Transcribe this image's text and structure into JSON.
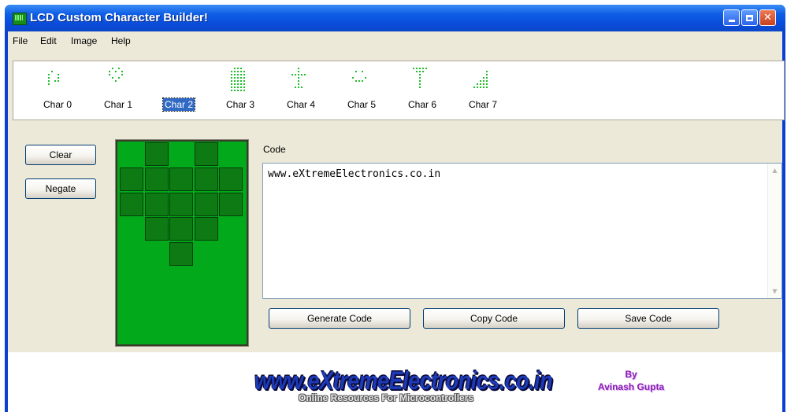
{
  "window": {
    "title": "LCD Custom Character Builder!"
  },
  "menu": {
    "items": [
      "File",
      "Edit",
      "Image",
      "Help"
    ]
  },
  "characters": {
    "selected": "Char 2",
    "items": [
      {
        "label": "Char 0",
        "rows": [
          0,
          0,
          0,
          0,
          0,
          0,
          1,
          0,
          0,
          0,
          1,
          0,
          0,
          1,
          0,
          1,
          0,
          0,
          1,
          0,
          1,
          0,
          1,
          1,
          0,
          1,
          0,
          0,
          0,
          0,
          0,
          0,
          0,
          0,
          0,
          0,
          0,
          0,
          0,
          0
        ]
      },
      {
        "label": "Char 1",
        "rows": [
          0,
          1,
          0,
          1,
          0,
          1,
          0,
          1,
          0,
          1,
          1,
          0,
          0,
          0,
          1,
          0,
          1,
          0,
          1,
          0,
          0,
          0,
          1,
          0,
          0,
          0,
          0,
          0,
          0,
          0,
          0,
          0,
          0,
          0,
          0,
          0,
          0,
          0,
          0,
          0
        ]
      },
      {
        "label": "Char 2",
        "rows": [
          0,
          0,
          0,
          0,
          0,
          0,
          0,
          0,
          0,
          0,
          0,
          0,
          0,
          0,
          0,
          0,
          0,
          0,
          0,
          0,
          0,
          0,
          0,
          0,
          0,
          0,
          0,
          0,
          0,
          0,
          0,
          0,
          0,
          0,
          0,
          0,
          0,
          0,
          0,
          0
        ]
      },
      {
        "label": "Char 3",
        "rows": [
          0,
          1,
          1,
          1,
          0,
          1,
          1,
          1,
          1,
          1,
          1,
          1,
          1,
          1,
          1,
          1,
          1,
          1,
          1,
          1,
          1,
          1,
          1,
          1,
          1,
          1,
          1,
          1,
          1,
          1,
          1,
          1,
          1,
          1,
          1,
          1,
          1,
          1,
          1,
          1
        ]
      },
      {
        "label": "Char 4",
        "rows": [
          0,
          0,
          1,
          0,
          0,
          0,
          0,
          1,
          0,
          0,
          1,
          1,
          1,
          1,
          1,
          0,
          0,
          1,
          0,
          0,
          0,
          0,
          1,
          0,
          0,
          0,
          0,
          1,
          0,
          0,
          0,
          1,
          1,
          1,
          0,
          0,
          0,
          0,
          0,
          0
        ]
      },
      {
        "label": "Char 5",
        "rows": [
          0,
          0,
          0,
          0,
          0,
          0,
          1,
          0,
          1,
          0,
          0,
          0,
          0,
          0,
          0,
          1,
          0,
          0,
          0,
          1,
          0,
          1,
          1,
          1,
          0,
          0,
          0,
          0,
          0,
          0,
          0,
          0,
          0,
          0,
          0,
          0,
          0,
          0,
          0,
          0
        ]
      },
      {
        "label": "Char 6",
        "rows": [
          1,
          1,
          1,
          1,
          1,
          0,
          1,
          1,
          1,
          0,
          0,
          0,
          1,
          0,
          0,
          0,
          0,
          1,
          0,
          0,
          0,
          0,
          1,
          0,
          0,
          0,
          0,
          1,
          0,
          0,
          0,
          0,
          1,
          0,
          0,
          0,
          0,
          0,
          0,
          0
        ]
      },
      {
        "label": "Char 7",
        "rows": [
          0,
          0,
          0,
          0,
          0,
          0,
          0,
          0,
          0,
          1,
          0,
          0,
          0,
          0,
          1,
          0,
          0,
          0,
          1,
          1,
          0,
          0,
          1,
          1,
          1,
          0,
          1,
          1,
          1,
          1,
          1,
          1,
          1,
          1,
          1,
          0,
          0,
          0,
          0,
          0
        ]
      }
    ]
  },
  "buttons": {
    "clear": "Clear",
    "negate": "Negate",
    "generate": "Generate Code",
    "copy": "Copy Code",
    "save": "Save Code"
  },
  "editor": {
    "columns": 5,
    "rows": 8,
    "pixels": [
      [
        0,
        1,
        0,
        1,
        0
      ],
      [
        1,
        1,
        1,
        1,
        1
      ],
      [
        1,
        1,
        1,
        1,
        1
      ],
      [
        0,
        1,
        1,
        1,
        0
      ],
      [
        0,
        0,
        1,
        0,
        0
      ],
      [
        0,
        0,
        0,
        0,
        0
      ],
      [
        0,
        0,
        0,
        0,
        0
      ],
      [
        0,
        0,
        0,
        0,
        0
      ]
    ]
  },
  "code": {
    "label": "Code",
    "text": "www.eXtremeElectronics.co.in"
  },
  "footer": {
    "logo_main": "www.eXtremeElectronics.co.in",
    "logo_sub": "Online Resources For Microcontrollers",
    "author_by": "By",
    "author_name": "Avinash Gupta"
  },
  "colors": {
    "lcd_background": "#01a91b",
    "lcd_pixel_on": "#0d7a14",
    "titlebar": "#0a4ddb"
  }
}
